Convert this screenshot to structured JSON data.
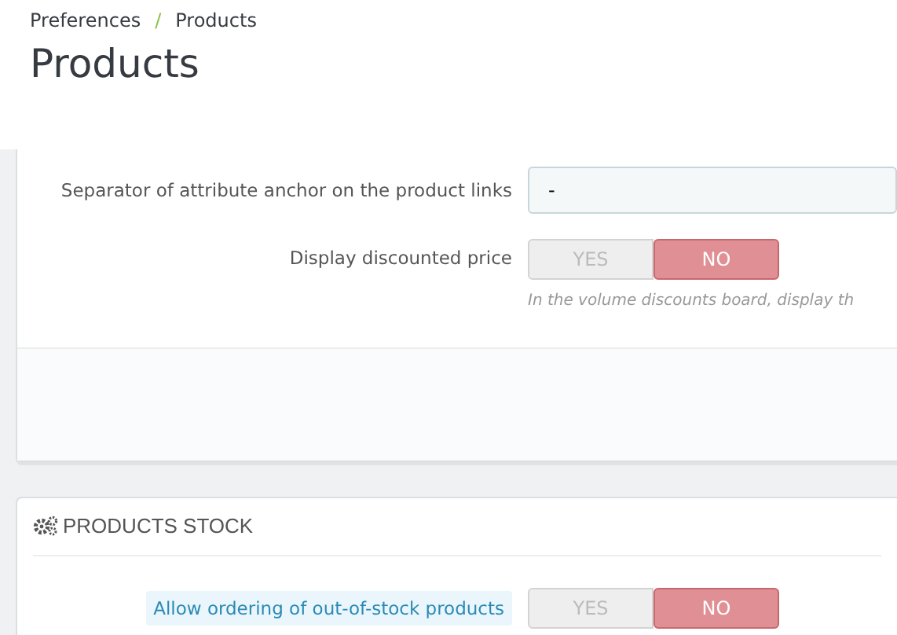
{
  "breadcrumb": [
    "Preferences",
    "Products"
  ],
  "breadcrumb_separator": "/",
  "title": "Products",
  "panels": [
    {
      "fields": [
        {
          "kind": "text",
          "label": "Separator of attribute anchor on the product links",
          "label_highlighted": false,
          "value": "-"
        },
        {
          "kind": "switch",
          "label": "Display discounted price",
          "label_highlighted": false,
          "options": [
            {
              "label": "YES",
              "selected": false
            },
            {
              "label": "NO",
              "selected": true
            }
          ],
          "help": "In the volume discounts board, display th"
        }
      ],
      "footer": true
    },
    {
      "heading": "PRODUCTS STOCK",
      "fields": [
        {
          "kind": "switch",
          "label": "Allow ordering of out-of-stock products",
          "label_highlighted": true,
          "options": [
            {
              "label": "YES",
              "selected": false
            },
            {
              "label": "NO",
              "selected": true
            }
          ]
        }
      ],
      "footer": false
    }
  ]
}
